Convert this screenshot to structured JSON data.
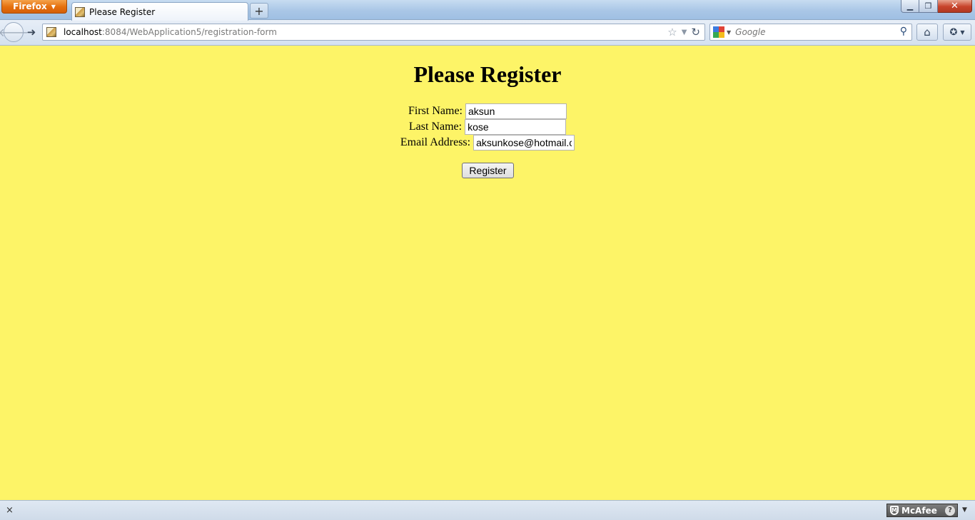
{
  "browser": {
    "menu_button_label": "Firefox",
    "tab_title": "Please Register",
    "new_tab_symbol": "+",
    "window_controls": {
      "minimize": "▁",
      "maximize": "❐",
      "close": "✕"
    },
    "url_host": "localhost",
    "url_rest": ":8084/WebApplication5/registration-form",
    "search_placeholder": "Google",
    "icons": [
      "back-icon",
      "forward-icon",
      "bookmark-star-icon",
      "history-dropdown-icon",
      "reload-icon",
      "search-icon",
      "home-icon",
      "bookmarks-icon"
    ]
  },
  "page": {
    "title": "Please Register",
    "background_color": "#fdf467",
    "form": {
      "first_name_label": "First Name:",
      "first_name_value": "aksun",
      "last_name_label": "Last Name:",
      "last_name_value": "kose",
      "email_label": "Email Address:",
      "email_value": "aksunkose@hotmail.com",
      "submit_label": "Register"
    }
  },
  "statusbar": {
    "close_symbol": "×",
    "mcafee_label": "McAfee",
    "mcafee_help": "?"
  }
}
